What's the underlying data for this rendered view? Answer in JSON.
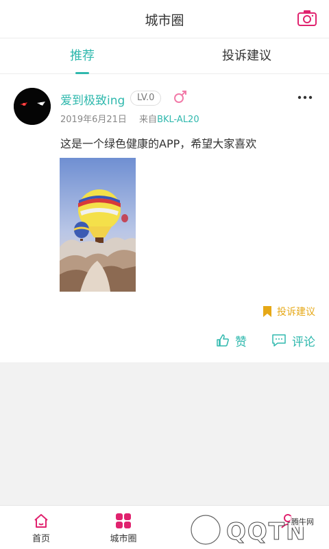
{
  "header": {
    "title": "城市圈",
    "camera_icon": "camera-icon"
  },
  "tabs": [
    {
      "label": "推荐",
      "active": true
    },
    {
      "label": "投诉建议",
      "active": false
    }
  ],
  "post": {
    "username": "爱到极致ing",
    "level": "LV.0",
    "gender_icon": "male-icon",
    "date": "2019年6月21日",
    "from_label": "来自",
    "device": "BKL-AL20",
    "content": "这是一个绿色健康的APP，希望大家喜欢",
    "complaint_label": "投诉建议",
    "like_label": "赞",
    "comment_label": "评论"
  },
  "bottom_nav": [
    {
      "label": "首页",
      "icon": "home-icon"
    },
    {
      "label": "城市圈",
      "icon": "grid-icon",
      "active": true
    },
    {
      "label": "",
      "icon": ""
    },
    {
      "label": "",
      "icon": "user-icon"
    }
  ],
  "watermark": {
    "text": "QQTN",
    "small_text": "腾牛网"
  },
  "colors": {
    "accent": "#2fb8ad",
    "brand_pink": "#e0226e",
    "complaint": "#e6a817"
  }
}
